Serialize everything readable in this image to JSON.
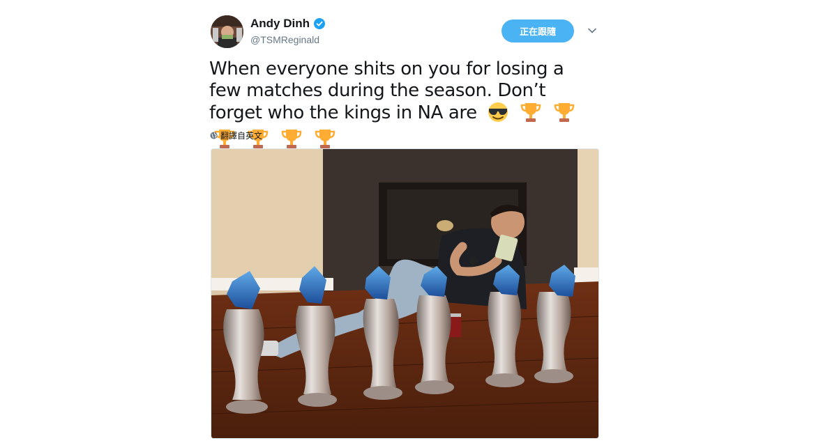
{
  "user": {
    "display_name": "Andy Dinh",
    "handle": "@TSMReginald",
    "verified": true,
    "avatar": "profile-photo"
  },
  "follow_button": {
    "label": "正在跟隨",
    "color": "#4ab3f4"
  },
  "menu": {
    "icon": "chevron-down-icon"
  },
  "tweet": {
    "text": "When everyone shits on you for losing a few matches during the season. Don’t forget who the kings in NA are",
    "emojis": [
      "smiling-face-with-sunglasses",
      "trophy",
      "trophy",
      "trophy",
      "trophy",
      "trophy",
      "trophy"
    ]
  },
  "translate": {
    "label": "翻譯自英文",
    "icon": "globe-icon"
  },
  "media": {
    "description_icon": "photo"
  },
  "colors": {
    "accent": "#1da1f2",
    "text": "#14171a",
    "secondary": "#657786"
  }
}
